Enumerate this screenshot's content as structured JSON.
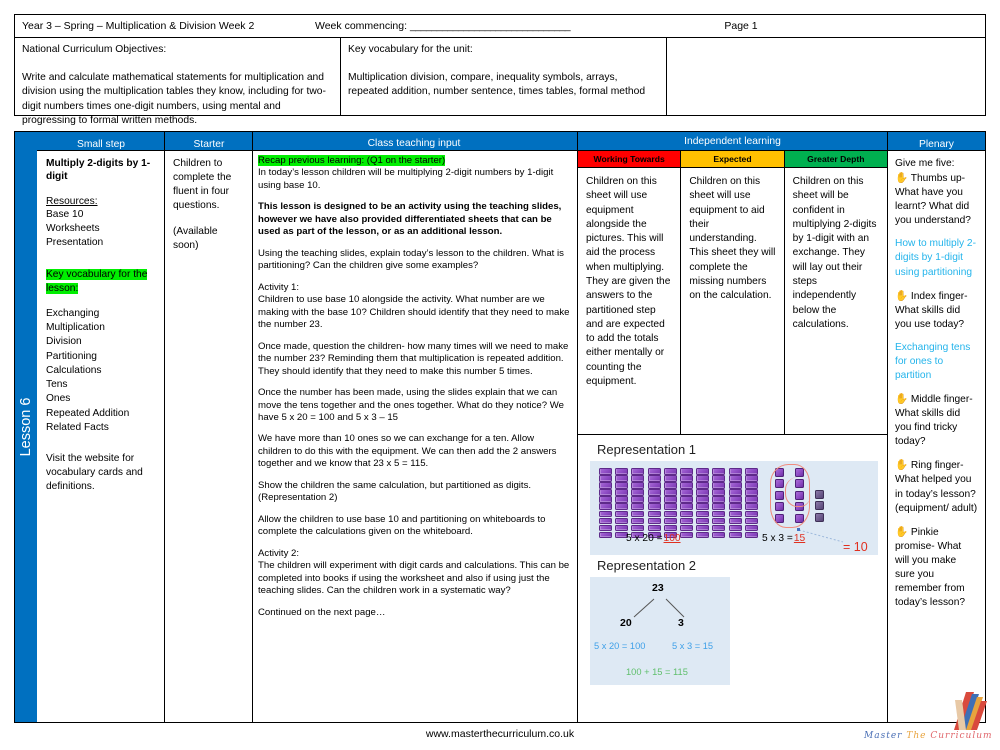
{
  "meta": {
    "title": "Year 3 – Spring – Multiplication & Division Week 2",
    "week_commencing_label": "Week commencing:",
    "week_commencing_blank": "______________________________",
    "page_label": "Page 1",
    "nc_heading": "National Curriculum Objectives:",
    "nc_body": "Write and calculate mathematical statements for multiplication and division using the multiplication tables they know, including for two-digit numbers times one-digit numbers, using mental and progressing to formal written methods.",
    "vocab_heading": "Key vocabulary for the unit:",
    "vocab_body": "Multiplication division, compare, inequality symbols, arrays, repeated addition, number sentence, times tables, formal method"
  },
  "lesson_tab": "Lesson 6",
  "headers": {
    "small_step": "Small step",
    "starter": "Starter",
    "class_teaching": "Class teaching input",
    "independent": "Independent learning",
    "plenary": "Plenary"
  },
  "small_step": {
    "title": "Multiply 2-digits by 1-digit",
    "resources_heading": "Resources:",
    "resources": [
      "Base 10",
      "Worksheets",
      "Presentation"
    ],
    "vocab_heading": "Key vocabulary for the lesson:",
    "vocab": [
      "Exchanging",
      "Multiplication",
      "Division",
      "Partitioning",
      "Calculations",
      "Tens",
      "Ones",
      "Repeated Addition",
      "Related Facts"
    ],
    "footer_note": "Visit the website for vocabulary cards and definitions."
  },
  "starter": {
    "line1": "Children to complete the fluent in four questions.",
    "line2": "(Available soon)"
  },
  "teaching": {
    "recap_heading": "Recap previous learning: (Q1 on the starter)",
    "recap_body": "In today’s lesson children will be multiplying 2-digit numbers by 1-digit using base 10.",
    "bold_note": "This lesson is designed to be an activity using the teaching slides, however we have also provided differentiated sheets that can be used as part of the lesson, or as an additional lesson.",
    "p1": "Using the teaching slides, explain today’s lesson to the children. What is partitioning? Can the children give some examples?",
    "activity1_label": "Activity 1:",
    "activity1_body": "Children to use base 10 alongside the activity. What number are we making with the base 10? Children should identify that they need to make the number 23.",
    "p2": "Once made, question the children- how many times will we need to make the number 23? Reminding them that multiplication is repeated addition. They should identify that they need to make this number 5 times.",
    "p3": "Once the number has been made, using the slides explain that we can move the tens together and the ones together. What do they notice? We have 5 x 20 = 100 and 5 x 3 – 15",
    "p4": "We have more than 10 ones so we can exchange for a ten. Allow children to do this with the equipment. We can then add the 2 answers together and we know that 23 x 5 = 115.",
    "p5": "Show the children the same calculation, but partitioned as digits. (Representation 2)",
    "p6": "Allow the children to use base 10 and partitioning on whiteboards to complete the calculations given on the whiteboard.",
    "activity2_label": "Activity 2:",
    "activity2_body": "The children will experiment with digit cards and calculations. This can be completed into books if using the worksheet and also if using just the teaching slides. Can the children work in a systematic way?",
    "continued": "Continued on the next page…"
  },
  "independent": {
    "columns": [
      {
        "label": "Working Towards",
        "color": "#FF0000",
        "body": "Children on this sheet will use equipment alongside the pictures. This will aid the process when multiplying. They are given the answers to the partitioned step and are expected to add the totals either mentally or counting the equipment."
      },
      {
        "label": "Expected",
        "color": "#FFC000",
        "body": "Children on this sheet will use equipment to aid their understanding. This sheet they will complete the missing numbers on the calculation."
      },
      {
        "label": "Greater Depth",
        "color": "#00B050",
        "body": "Children on this sheet will be confident in multiplying 2-digits by 1-digit with an exchange. They will lay out their steps independently below the calculations."
      }
    ]
  },
  "representations": {
    "rep1_title": "Representation 1",
    "rep2_title": "Representation 2",
    "rep1": {
      "tens_rods": 10,
      "cubes_per_rod": 10,
      "eq_tens_label": "5 x 20 =",
      "eq_tens_answer": "100",
      "eq_ones_label": "5 x 3 =",
      "eq_ones_answer": "15",
      "exchange_note": "= 10",
      "ones_columns": [
        5,
        5,
        3
      ]
    },
    "rep2": {
      "whole": "23",
      "part_a": "20",
      "part_b": "3",
      "eq_a": "5 x 20 = 100",
      "eq_b": "5 x 3 = 15",
      "eq_total": "100 + 15 = 115"
    }
  },
  "plenary": {
    "intro": "Give me five:",
    "items": [
      {
        "icon": "hand-icon",
        "text": " Thumbs up- What have you learnt? What did you understand?",
        "answer": ""
      },
      {
        "icon": "",
        "text": "",
        "answer": "How to multiply 2-digits by 1-digit using partitioning"
      },
      {
        "icon": "hand-icon",
        "text": " Index finger- What skills did you use today?",
        "answer": "Exchanging tens for ones to partition"
      },
      {
        "icon": "hand-icon",
        "text": " Middle finger- What skills did you find tricky today?",
        "answer": ""
      },
      {
        "icon": "hand-icon",
        "text": " Ring finger- What helped you in today’s lesson? (equipment/ adult)",
        "answer": ""
      },
      {
        "icon": "hand-icon",
        "text": " Pinkie promise- What will you make sure you remember from today’s lesson?",
        "answer": ""
      }
    ]
  },
  "footer": {
    "website": "www.masterthecurriculum.co.uk",
    "logo_word1": "Master",
    "logo_word2": "The",
    "logo_word3": "Curriculum"
  },
  "colors": {
    "header_blue": "#0070C0",
    "highlight_green": "#00EE00",
    "working_towards": "#FF0000",
    "expected": "#FFC000",
    "greater_depth": "#00B050",
    "cyan_text": "#24B4EB",
    "rep_bg": "#DEE9F4"
  }
}
